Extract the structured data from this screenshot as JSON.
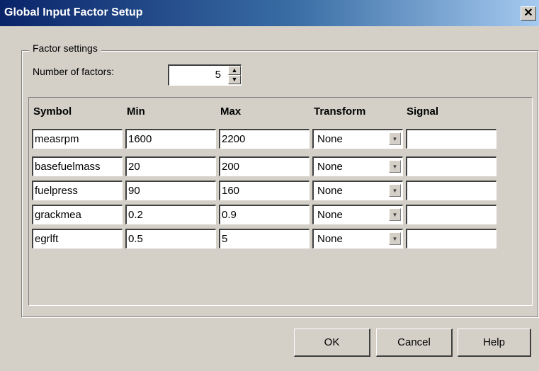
{
  "window": {
    "title": "Global Input Factor Setup",
    "close_glyph": "✕"
  },
  "group": {
    "legend": "Factor settings",
    "num_factors_label": "Number of factors:",
    "num_factors_value": "5"
  },
  "table": {
    "headers": {
      "symbol": "Symbol",
      "min": "Min",
      "max": "Max",
      "transform": "Transform",
      "signal": "Signal"
    },
    "rows": [
      {
        "symbol": "measrpm",
        "min": "1600",
        "max": "2200",
        "transform": "None",
        "signal": ""
      },
      {
        "symbol": "basefuelmass",
        "min": "20",
        "max": "200",
        "transform": "None",
        "signal": ""
      },
      {
        "symbol": "fuelpress",
        "min": "90",
        "max": "160",
        "transform": "None",
        "signal": ""
      },
      {
        "symbol": "grackmea",
        "min": "0.2",
        "max": "0.9",
        "transform": "None",
        "signal": ""
      },
      {
        "symbol": "egrlft",
        "min": "0.5",
        "max": "5",
        "transform": "None",
        "signal": ""
      }
    ]
  },
  "buttons": {
    "ok": "OK",
    "cancel": "Cancel",
    "help": "Help"
  },
  "icons": {
    "spin_up": "spin-up-arrow-icon",
    "spin_down": "spin-down-arrow-icon",
    "dropdown": "chevron-down-icon",
    "close": "close-icon"
  }
}
